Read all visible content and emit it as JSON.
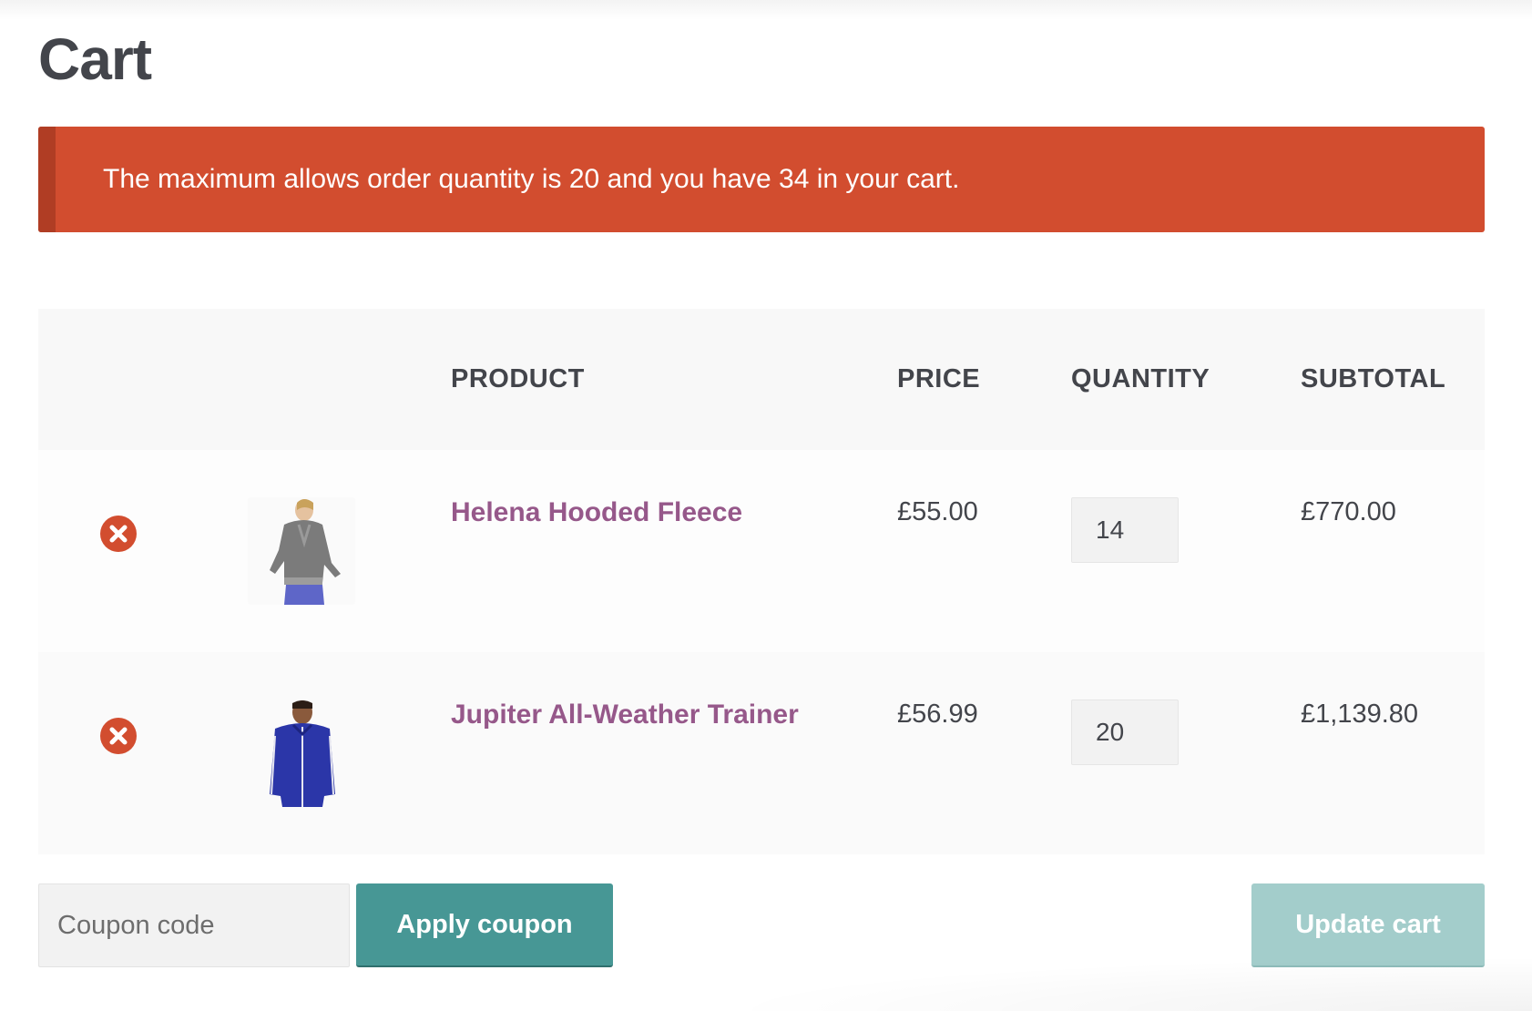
{
  "page": {
    "title": "Cart"
  },
  "notice": {
    "text": "The maximum allows order quantity is 20 and you have 34 in your cart.",
    "color": "#d24d2f"
  },
  "table": {
    "headers": {
      "product": "PRODUCT",
      "price": "PRICE",
      "quantity": "QUANTITY",
      "subtotal": "SUBTOTAL"
    },
    "rows": [
      {
        "name": "Helena Hooded Fleece",
        "price": "£55.00",
        "quantity": "14",
        "subtotal": "£770.00",
        "thumbnail_icon": "grey-hooded-fleece-image"
      },
      {
        "name": "Jupiter All-Weather Trainer",
        "price": "£56.99",
        "quantity": "20",
        "subtotal": "£1,139.80",
        "thumbnail_icon": "blue-track-jacket-image"
      }
    ]
  },
  "actions": {
    "coupon_placeholder": "Coupon code",
    "apply_coupon_label": "Apply coupon",
    "update_cart_label": "Update cart"
  },
  "colors": {
    "accent_teal": "#479795",
    "disabled_teal": "#a3cdcb",
    "link_purple": "#96588a",
    "error_red": "#d24d2f"
  }
}
